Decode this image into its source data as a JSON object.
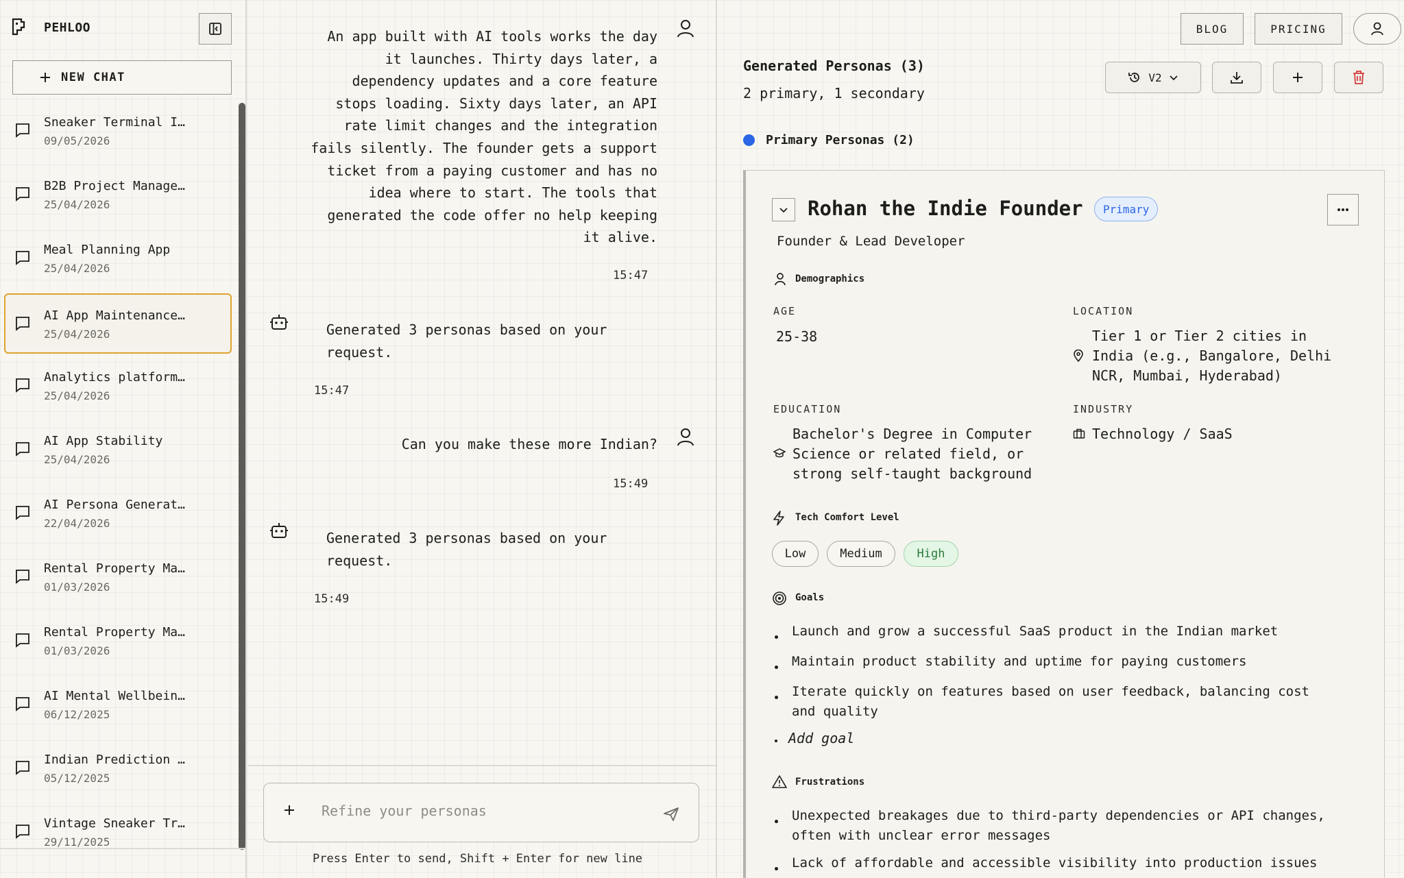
{
  "app": {
    "name": "PEHLOO"
  },
  "sidebar": {
    "new_chat_label": "NEW CHAT",
    "chats": [
      {
        "title": "Sneaker Terminal I…",
        "date": "09/05/2026"
      },
      {
        "title": "B2B Project Manage…",
        "date": "25/04/2026"
      },
      {
        "title": "Meal Planning App",
        "date": "25/04/2026"
      },
      {
        "title": "AI App Maintenance…",
        "date": "25/04/2026",
        "active": true
      },
      {
        "title": "Analytics platform…",
        "date": "25/04/2026"
      },
      {
        "title": "AI App Stability",
        "date": "25/04/2026"
      },
      {
        "title": "AI Persona Generat…",
        "date": "22/04/2026"
      },
      {
        "title": "Rental Property Ma…",
        "date": "01/03/2026"
      },
      {
        "title": "Rental Property Ma…",
        "date": "01/03/2026"
      },
      {
        "title": "AI Mental Wellbein…",
        "date": "06/12/2025"
      },
      {
        "title": "Indian Prediction …",
        "date": "05/12/2025"
      },
      {
        "title": "Vintage Sneaker Tr…",
        "date": "29/11/2025"
      }
    ]
  },
  "chat": {
    "messages": [
      {
        "role": "user",
        "lines": [
          "An app built with AI tools works the day",
          "it launches. Thirty days later, a",
          "dependency updates and a core feature",
          "stops loading. Sixty days later, an API",
          "rate limit changes and the integration",
          "fails silently. The founder gets a support",
          "ticket from a paying customer and has no",
          "idea where to start. The tools that",
          "generated the code offer no help keeping",
          "it alive."
        ],
        "time": "15:47"
      },
      {
        "role": "assistant",
        "lines": [
          "Generated 3 personas based on your",
          "request."
        ],
        "time": "15:47"
      },
      {
        "role": "user",
        "lines": [
          "Can you make these more Indian?"
        ],
        "time": "15:49"
      },
      {
        "role": "assistant",
        "lines": [
          "Generated 3 personas based on your",
          "request."
        ],
        "time": "15:49"
      }
    ],
    "input_placeholder": "Refine your personas",
    "hint": "Press Enter to send, Shift + Enter for new line"
  },
  "nav": {
    "blog": "BLOG",
    "pricing": "PRICING"
  },
  "personas": {
    "title": "Generated Personas (3)",
    "subtitle": "2 primary, 1 secondary",
    "version": "V2",
    "primary_section": "Primary Personas (2)",
    "colors": {
      "primary_dot": "#2a66e6",
      "delete": "#d23b3b",
      "active_chat": "#e0a32e",
      "high_pill": "#e4f6e6"
    },
    "card": {
      "name": "Rohan the Indie Founder",
      "badge": "Primary",
      "role": "Founder & Lead Developer",
      "demographics_heading": "Demographics",
      "age_label": "AGE",
      "age": "25-38",
      "location_label": "LOCATION",
      "location_lines": [
        "Tier 1 or Tier 2 cities in",
        "India (e.g., Bangalore, Delhi",
        "NCR, Mumbai, Hyderabad)"
      ],
      "education_label": "EDUCATION",
      "education_lines": [
        "Bachelor's Degree in Computer",
        "Science or related field, or",
        "strong self-taught background"
      ],
      "industry_label": "INDUSTRY",
      "industry": "Technology / SaaS",
      "tech_heading": "Tech Comfort Level",
      "tech_levels": [
        "Low",
        "Medium",
        "High"
      ],
      "tech_selected": "High",
      "goals_heading": "Goals",
      "goals": [
        [
          "Launch and grow a successful SaaS product in the Indian market"
        ],
        [
          "Maintain product stability and uptime for paying customers"
        ],
        [
          "Iterate quickly on features based on user feedback, balancing cost",
          "and quality"
        ]
      ],
      "add_goal": "Add goal",
      "frustrations_heading": "Frustrations",
      "frustrations": [
        [
          "Unexpected breakages due to third-party dependencies or API changes,",
          "often with unclear error messages"
        ],
        [
          "Lack of affordable and accessible visibility into production issues"
        ]
      ]
    }
  }
}
